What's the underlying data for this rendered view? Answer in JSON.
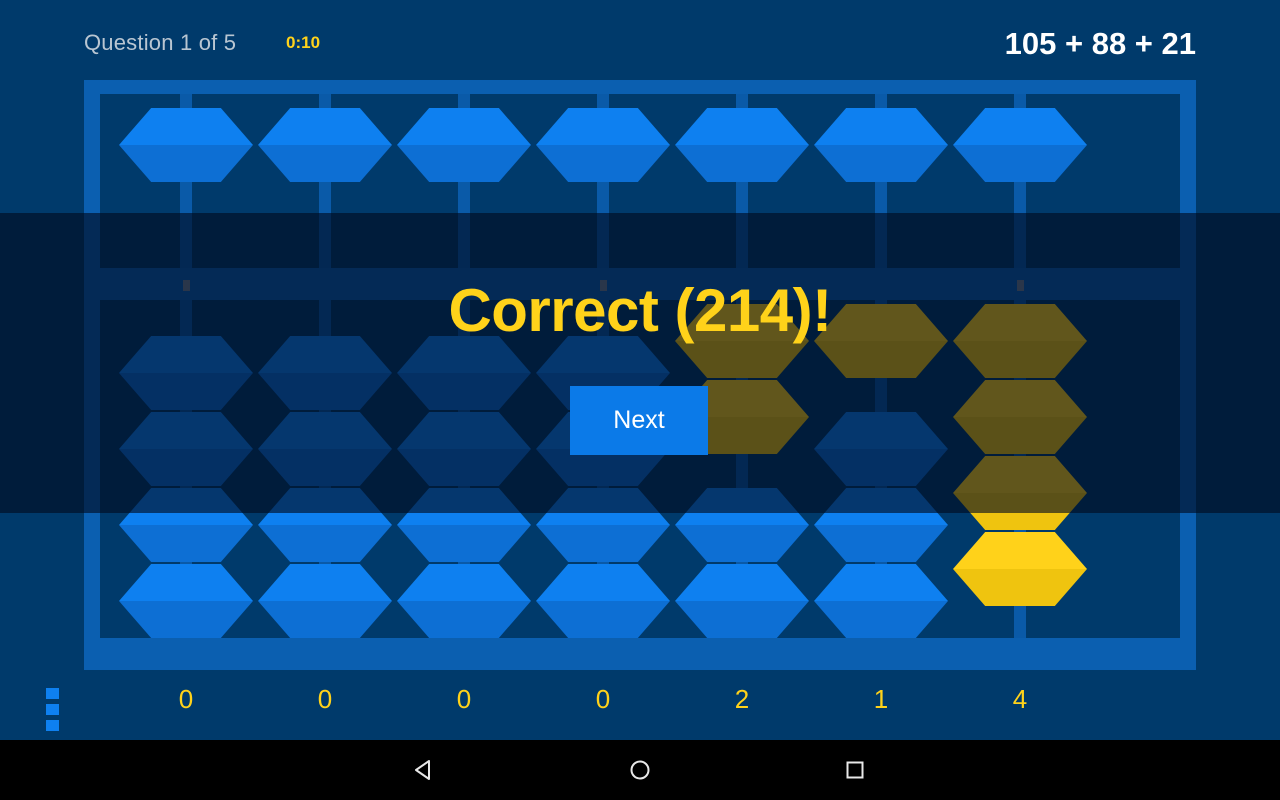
{
  "header": {
    "question_label": "Question 1 of 5",
    "timer": "0:10",
    "equation": "105 + 88 + 21"
  },
  "overlay": {
    "result_text": "Correct (214)!",
    "next_label": "Next"
  },
  "colors": {
    "background": "#003A6B",
    "frame": "#0B5FB0",
    "bead_blue": "#0E80F0",
    "bead_gold": "#FFD21A",
    "accent_yellow": "#FFD21A",
    "dim_overlay": "rgba(0,10,30,0.62)",
    "navbar": "#000000"
  },
  "abacus": {
    "columns": 7,
    "digits": [
      "0",
      "0",
      "0",
      "0",
      "2",
      "1",
      "4"
    ],
    "beam_dot_columns": [
      1,
      4,
      7
    ],
    "heaven_beads_per_column": 1,
    "earth_beads_per_column": 4,
    "column_values": [
      {
        "digit": "0",
        "heaven_active": false,
        "earth_active": 0
      },
      {
        "digit": "0",
        "heaven_active": false,
        "earth_active": 0
      },
      {
        "digit": "0",
        "heaven_active": false,
        "earth_active": 0
      },
      {
        "digit": "0",
        "heaven_active": false,
        "earth_active": 0
      },
      {
        "digit": "2",
        "heaven_active": false,
        "earth_active": 2
      },
      {
        "digit": "1",
        "heaven_active": false,
        "earth_active": 1
      },
      {
        "digit": "4",
        "heaven_active": false,
        "earth_active": 4
      }
    ],
    "displayed_value": "214"
  },
  "menu": {
    "icon": "overflow-menu-icon"
  },
  "navbar": {
    "back": "back-icon",
    "home": "home-icon",
    "recents": "recents-icon"
  }
}
